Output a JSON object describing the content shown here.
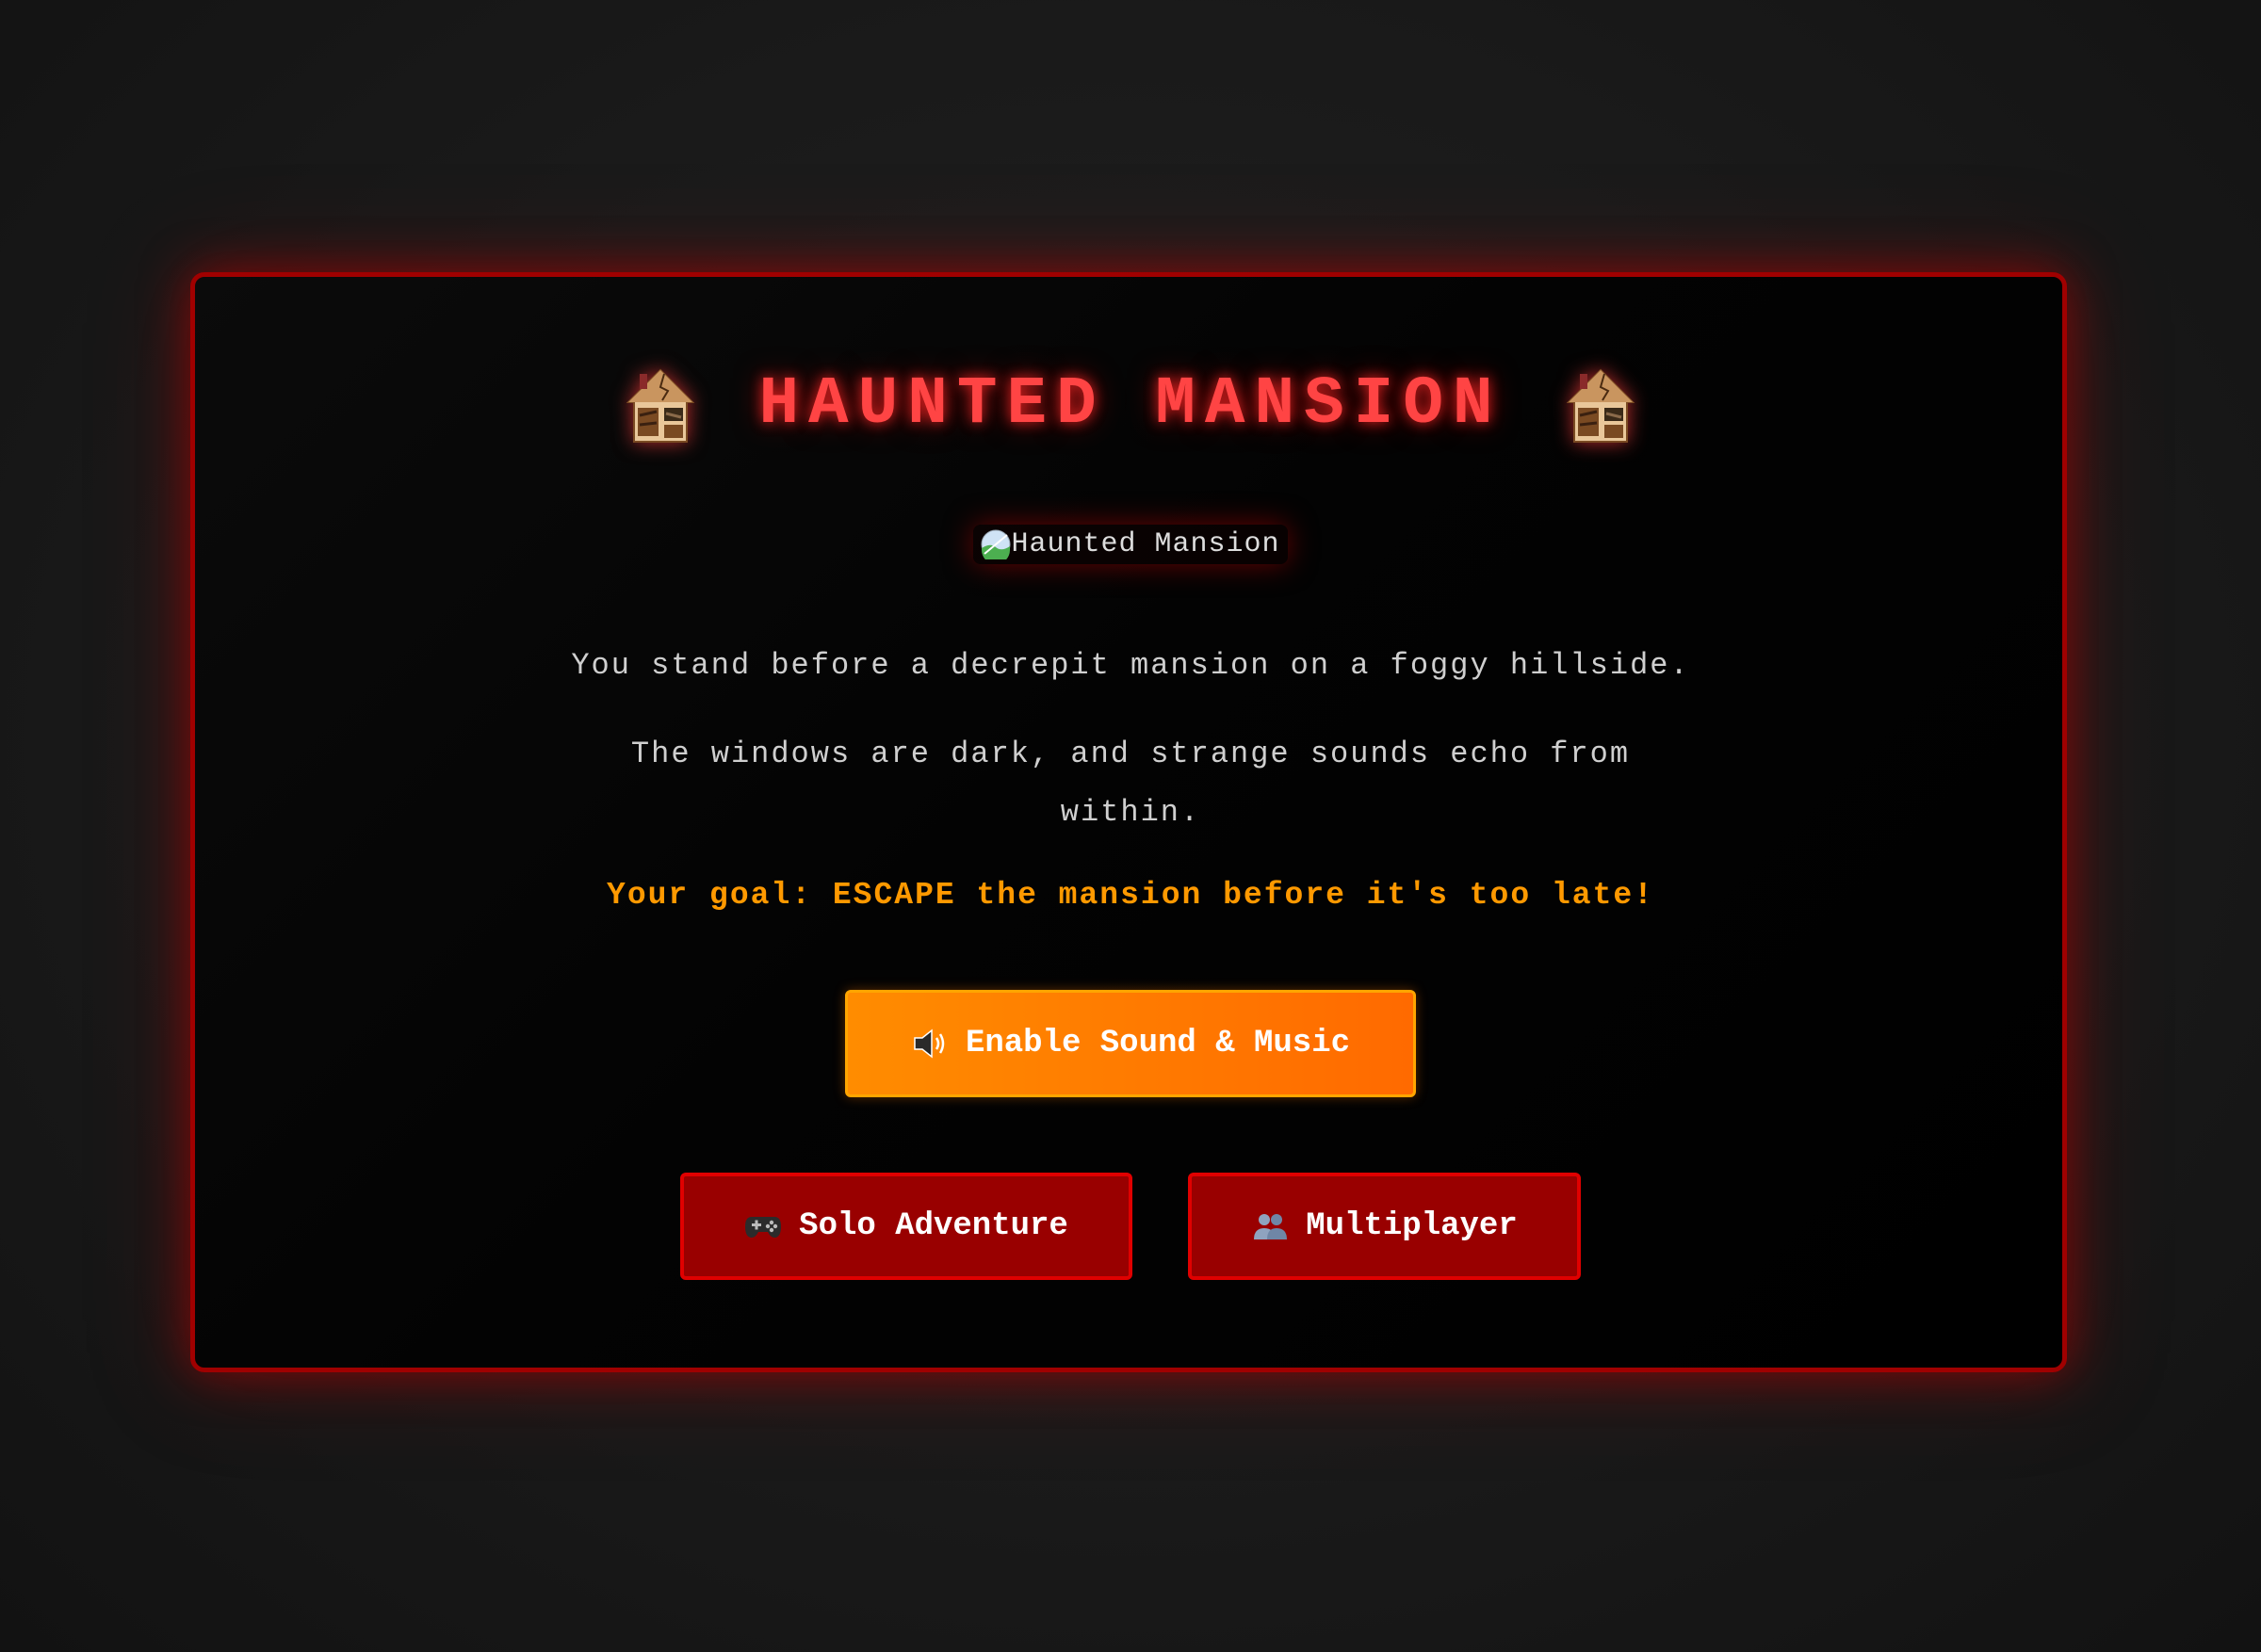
{
  "title": {
    "text": "HAUNTED MANSION",
    "icon_left": "haunted-house-icon",
    "icon_right": "haunted-house-icon",
    "color": "#ff4444"
  },
  "mansion_image": {
    "icon": "broken-image-icon",
    "alt_text": "Haunted Mansion"
  },
  "story": {
    "line_1": "You stand before a decrepit mansion on a foggy hillside.",
    "line_2": "The windows are dark, and strange sounds echo from within."
  },
  "goal": {
    "text": "Your goal: ESCAPE the mansion before it's too late!",
    "color": "#ff9900"
  },
  "buttons": {
    "sound": {
      "icon": "speaker-icon",
      "label": "Enable Sound & Music",
      "color": "#ff8c00"
    },
    "solo": {
      "icon": "gamepad-icon",
      "label": "Solo Adventure",
      "color": "#990000"
    },
    "multiplayer": {
      "icon": "users-icon",
      "label": "Multiplayer",
      "color": "#990000"
    }
  }
}
